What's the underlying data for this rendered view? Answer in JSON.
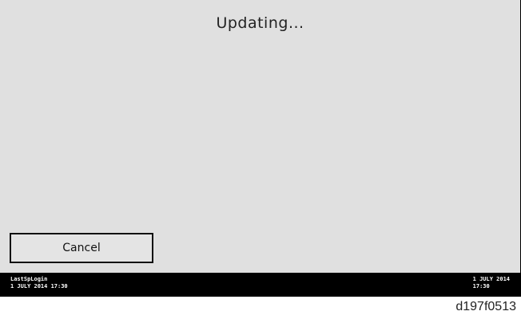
{
  "screen": {
    "title": "Updating...",
    "cancel_label": "Cancel"
  },
  "status_bar": {
    "left_line1": "LastSpLogin",
    "left_line2": "1 JULY 2014 17:30",
    "right_line1": "1 JULY 2014",
    "right_line2": "17:30"
  },
  "figure_id": "d197f0513",
  "colors": {
    "screen_bg": "#e0e0e0",
    "status_bar_bg": "#000000"
  }
}
